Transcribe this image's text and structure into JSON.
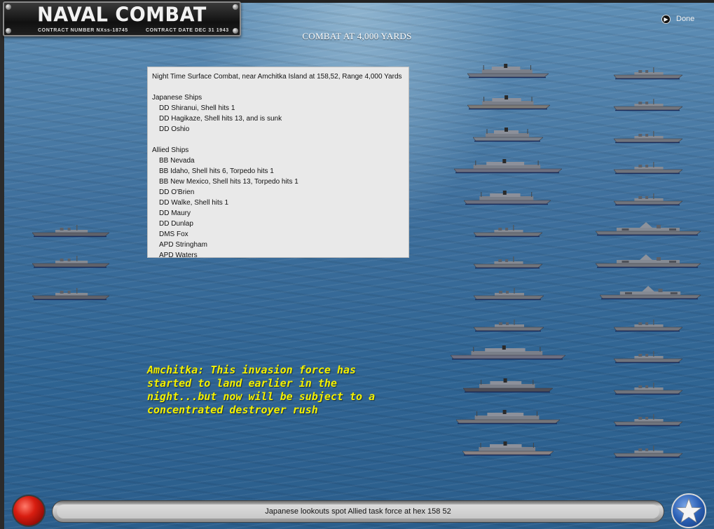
{
  "header": {
    "game_title": "NAVAL COMBAT",
    "contract_number": "CONTRACT NUMBER  NXss-18745",
    "contract_date": "CONTRACT DATE  DEC 31 1943"
  },
  "combat_heading": "COMBAT AT 4,000 YARDS",
  "done_label": "Done",
  "report": {
    "lines": [
      {
        "text": "Night Time Surface Combat, near Amchitka Island at 158,52, Range 4,000 Yards",
        "indent": false
      },
      {
        "text": "",
        "indent": false
      },
      {
        "text": "Japanese Ships",
        "indent": false
      },
      {
        "text": "DD Shiranui, Shell hits 1",
        "indent": true
      },
      {
        "text": "DD Hagikaze, Shell hits 13, and is sunk",
        "indent": true
      },
      {
        "text": "DD Oshio",
        "indent": true
      },
      {
        "text": "",
        "indent": false
      },
      {
        "text": "Allied Ships",
        "indent": false
      },
      {
        "text": "BB Nevada",
        "indent": true
      },
      {
        "text": "BB Idaho, Shell hits 6, Torpedo hits 1",
        "indent": true
      },
      {
        "text": "BB New Mexico, Shell hits 13, Torpedo hits 1",
        "indent": true
      },
      {
        "text": "DD O'Brien",
        "indent": true
      },
      {
        "text": "DD Walke, Shell hits 1",
        "indent": true
      },
      {
        "text": "DD Maury",
        "indent": true
      },
      {
        "text": "DD Dunlap",
        "indent": true
      },
      {
        "text": "DMS Fox",
        "indent": true
      },
      {
        "text": "APD Stringham",
        "indent": true
      },
      {
        "text": "APD Waters",
        "indent": true
      }
    ]
  },
  "scenario_note": "Amchitka:  This invasion force has started to land earlier in the night...but now will be subject to a concentrated destroyer rush",
  "status_message": "Japanese lookouts spot Allied task force at hex 158 52",
  "icons": {
    "done": "play-circle-icon",
    "end_turn": "red-button-icon",
    "allied": "star-roundel-icon"
  },
  "colors": {
    "scenario_text": "#f4f000",
    "sea": "#3f709d",
    "red_button": "#d81d10",
    "star_badge": "#2a5fb4"
  }
}
